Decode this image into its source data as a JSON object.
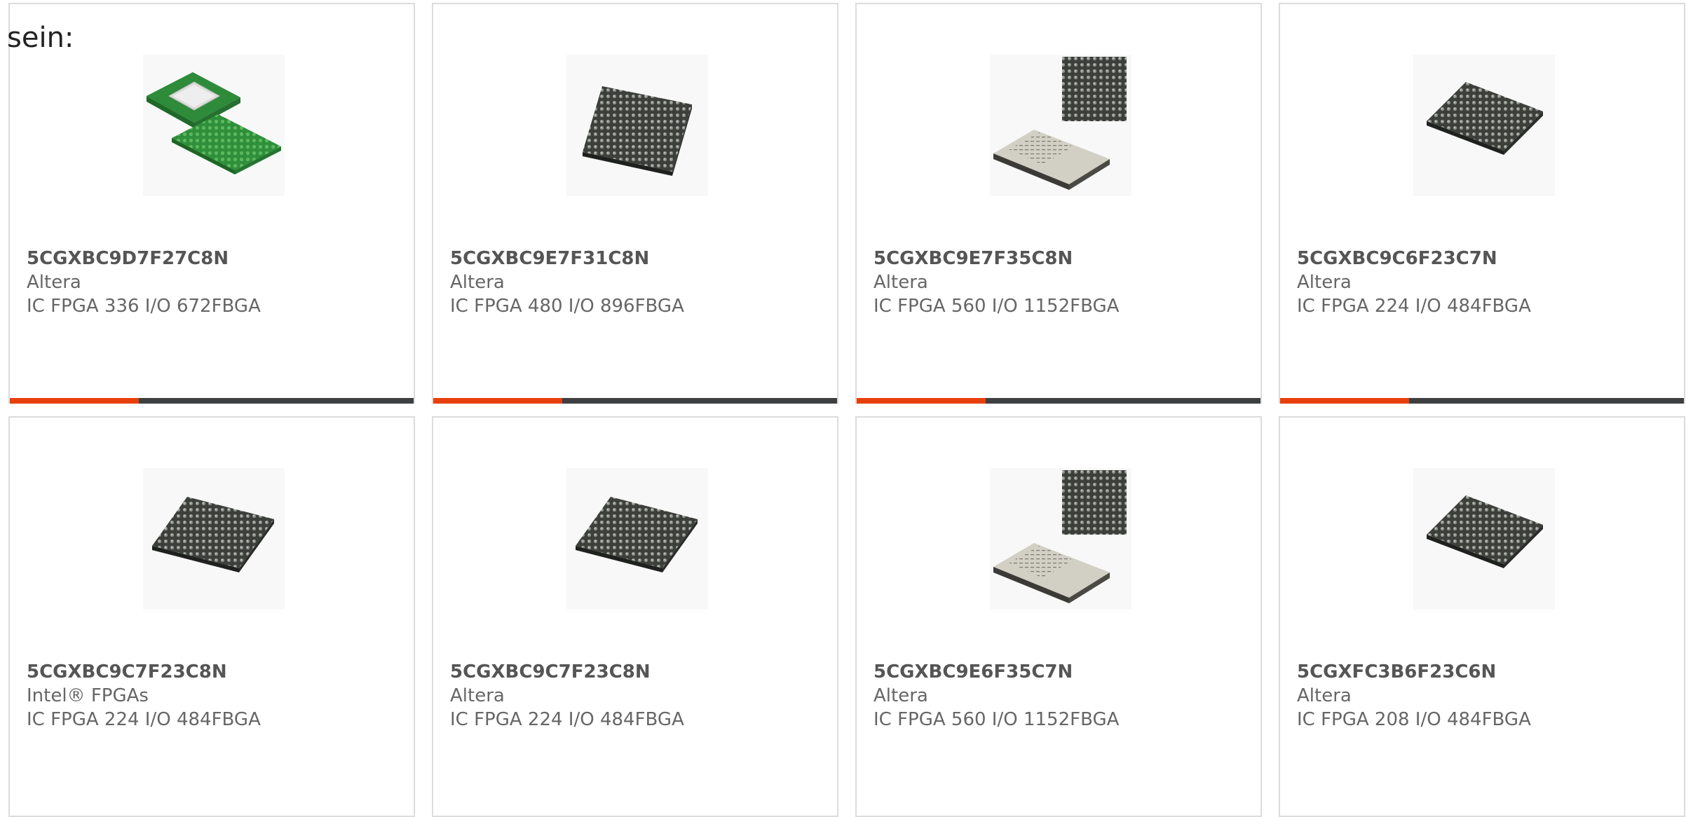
{
  "heading": "sein:",
  "colors": {
    "accent": "#e8400c",
    "bar_track": "#3d3f41",
    "card_border": "#dcdcdc",
    "text": "#666666"
  },
  "cards": [
    {
      "part": "5CGXBC9D7F27C8N",
      "manufacturer": "Altera",
      "description": "IC FPGA 336 I/O 672FBGA",
      "image": "green-bga-chip-with-lid-icon",
      "progress_fraction": 0.32
    },
    {
      "part": "5CGXBC9E7F31C8N",
      "manufacturer": "Altera",
      "description": "IC FPGA 480 I/O 896FBGA",
      "image": "dark-bga-chip-icon",
      "progress_fraction": 0.32
    },
    {
      "part": "5CGXBC9E7F35C8N",
      "manufacturer": "Altera",
      "description": "IC FPGA 560 I/O 1152FBGA",
      "image": "beige-bga-chip-icon",
      "progress_fraction": 0.32
    },
    {
      "part": "5CGXBC9C6F23C7N",
      "manufacturer": "Altera",
      "description": "IC FPGA 224 I/O 484FBGA",
      "image": "dark-bga-chip-icon",
      "progress_fraction": 0.32
    },
    {
      "part": "5CGXBC9C7F23C8N",
      "manufacturer": "Intel® FPGAs",
      "description": "IC FPGA 224 I/O 484FBGA",
      "image": "dark-bga-chip-icon",
      "progress_fraction": null
    },
    {
      "part": "5CGXBC9C7F23C8N",
      "manufacturer": "Altera",
      "description": "IC FPGA 224 I/O 484FBGA",
      "image": "dark-bga-chip-icon",
      "progress_fraction": null
    },
    {
      "part": "5CGXBC9E6F35C7N",
      "manufacturer": "Altera",
      "description": "IC FPGA 560 I/O 1152FBGA",
      "image": "beige-bga-chip-icon",
      "progress_fraction": null
    },
    {
      "part": "5CGXFC3B6F23C6N",
      "manufacturer": "Altera",
      "description": "IC FPGA 208 I/O 484FBGA",
      "image": "dark-bga-chip-icon",
      "progress_fraction": null
    }
  ]
}
